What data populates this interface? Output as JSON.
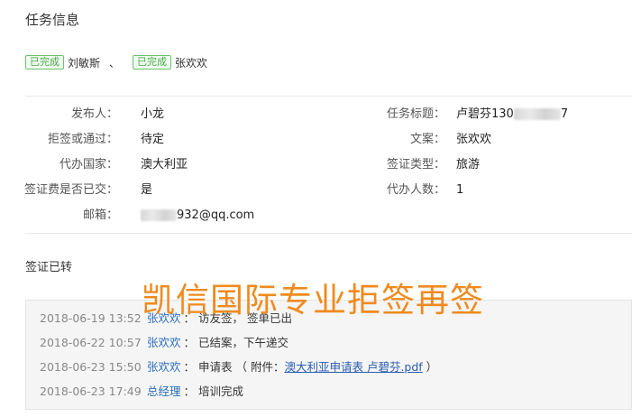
{
  "page": {
    "title": "任务信息"
  },
  "assignees": [
    {
      "status": "已完成",
      "name": "刘敏斯"
    },
    {
      "status": "已完成",
      "name": "张欢欢"
    }
  ],
  "assignee_separator": "、",
  "info": {
    "publisher": {
      "label": "发布人：",
      "value": "小龙"
    },
    "task_title": {
      "label": "任务标题：",
      "value_prefix": "卢碧芬130",
      "value_suffix": "7"
    },
    "rejected_or_passed": {
      "label": "拒签或通过：",
      "value": "待定"
    },
    "copywriter": {
      "label": "文案：",
      "value": "张欢欢"
    },
    "country": {
      "label": "代办国家：",
      "value": "澳大利亚"
    },
    "visa_type": {
      "label": "签证类型：",
      "value": "旅游"
    },
    "fee_paid": {
      "label": "签证费是否已交：",
      "value": "是"
    },
    "agent_count": {
      "label": "代办人数：",
      "value": "1"
    },
    "email": {
      "label": "邮箱：",
      "value_suffix": "932@qq.com"
    }
  },
  "section": {
    "title": "签证已转"
  },
  "watermark": "凯信国际专业拒签再签",
  "log_separator": "：",
  "logs": [
    {
      "time": "2018-06-19 13:52",
      "user": "张欢欢",
      "text": "访友签， 签单已出"
    },
    {
      "time": "2018-06-22 10:57",
      "user": "张欢欢",
      "text": "已结案，下午递交"
    },
    {
      "time": "2018-06-23 15:50",
      "user": "张欢欢",
      "text": "申请表 （ 附件：",
      "link": "澳大利亚申请表 卢碧芬.pdf",
      "text_after": " ）"
    },
    {
      "time": "2018-06-23 17:49",
      "user": "总经理",
      "text": "培训完成"
    }
  ]
}
